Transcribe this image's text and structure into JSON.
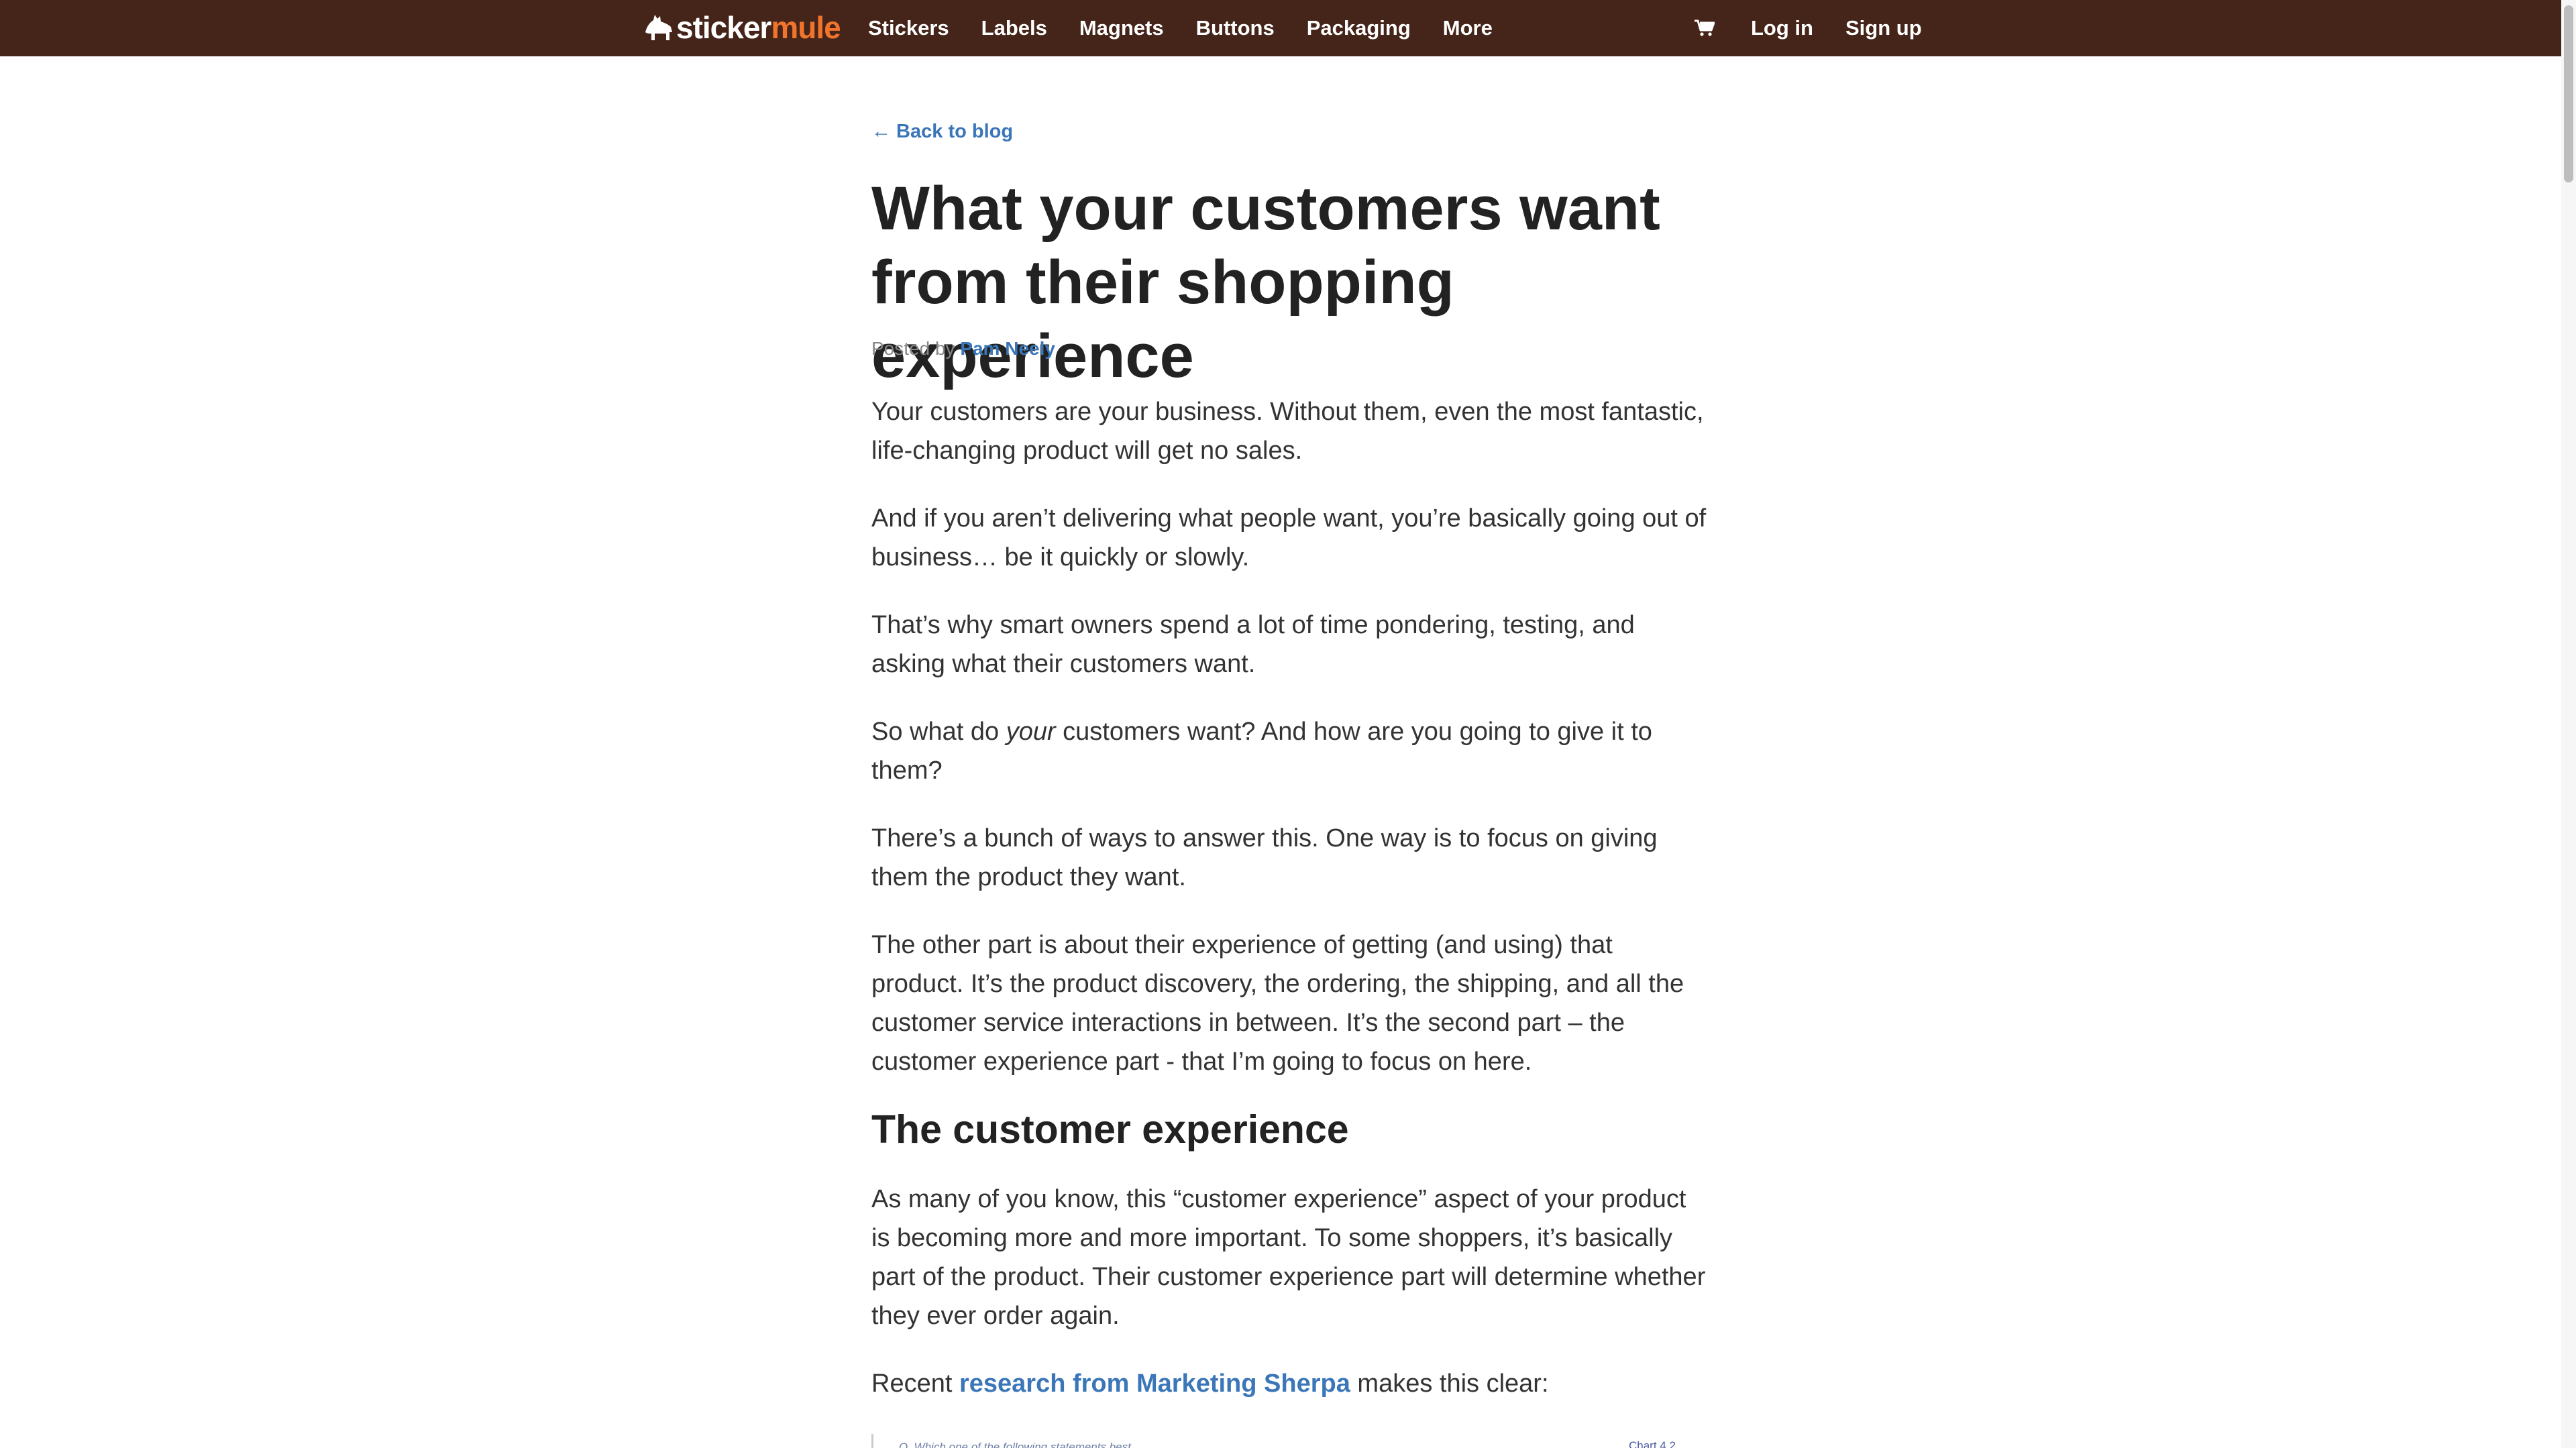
{
  "brand": {
    "logo_part1": "sticker",
    "logo_part2": "mule"
  },
  "nav": {
    "items": [
      "Stickers",
      "Labels",
      "Magnets",
      "Buttons",
      "Packaging",
      "More"
    ],
    "login": "Log in",
    "signup": "Sign up",
    "cart_icon": "shopping-cart-icon"
  },
  "article": {
    "back_link": "← Back to blog",
    "title": "What your customers want from their shopping experience",
    "byline_prefix": "Posted by",
    "author": "Pam Neely",
    "paragraphs": {
      "p1": "Your customers are your business. Without them, even the most fantastic, life-changing product will get no sales.",
      "p2": "And if you aren’t delivering what people want, you’re basically going out of business… be it quickly or slowly.",
      "p3": "That’s why smart owners spend a lot of time pondering, testing, and asking what their customers want.",
      "p4_before": "So what do ",
      "p4_em": "your",
      "p4_after": " customers want? And how are you going to give it to them?",
      "p5": "There’s a bunch of ways to answer this. One way is to focus on giving them the product they want.",
      "p6": "The other part is about their experience of getting (and using) that product. It’s the product discovery, the ordering, the shipping, and all the customer service interactions in between. It’s the second part – the customer experience part - that I’m going to focus on here.",
      "p7": "As many of you know, this “customer experience” aspect of your product is becoming more and more important. To some shoppers, it’s basically part of the product. Their customer experience part will determine whether they ever order again.",
      "p8_before": "Recent ",
      "p8_link": "research from Marketing Sherpa",
      "p8_after": " makes this clear:"
    },
    "heading_customer_experience": "The customer experience",
    "chart_preview": {
      "question": "Q. Which one of the following statements best...",
      "chart_link": "Chart 4.2"
    }
  },
  "colors": {
    "nav_bg": "#45251a",
    "brand_orange": "#f0742b",
    "link_blue": "#3a76b8",
    "heading": "#222222",
    "body_text": "#333333"
  }
}
